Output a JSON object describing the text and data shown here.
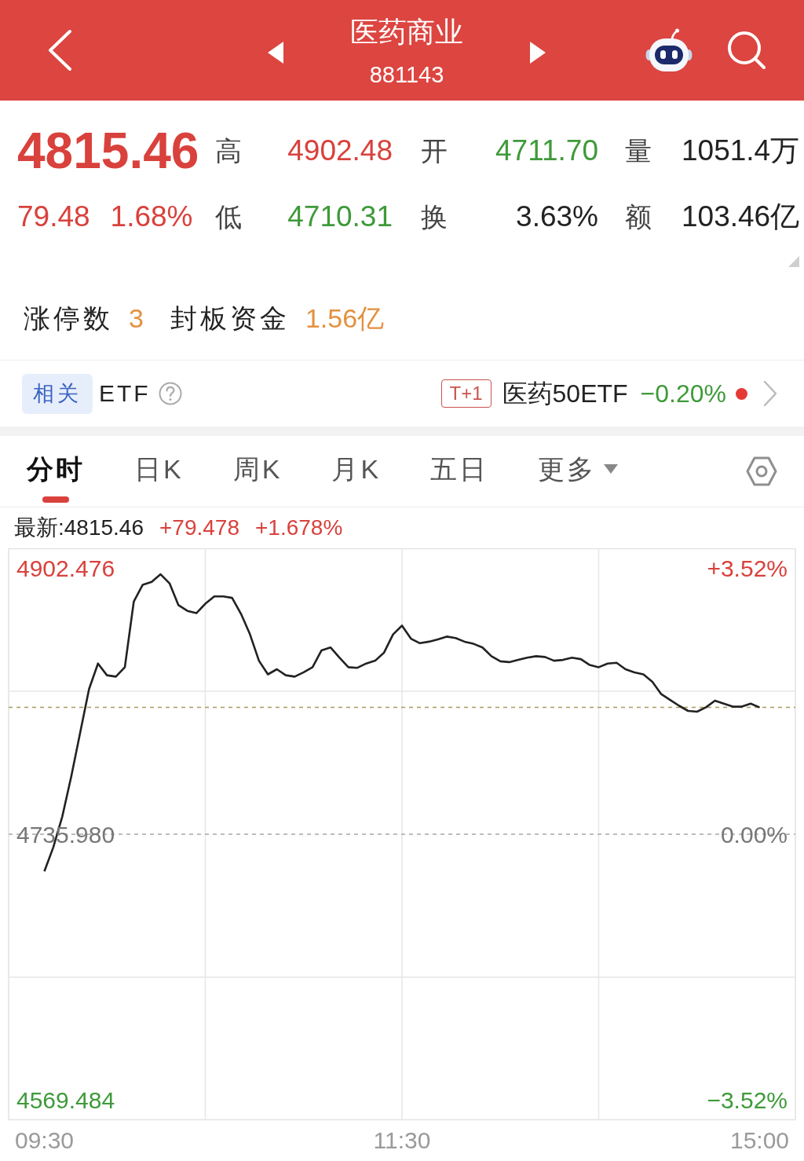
{
  "header": {
    "title": "医药商业",
    "code": "881143"
  },
  "quote": {
    "price": "4815.46",
    "change": "79.48",
    "change_percent": "1.68%",
    "stats": [
      {
        "label": "高",
        "value": "4902.48",
        "color": "#d9413c"
      },
      {
        "label": "开",
        "value": "4711.70",
        "color": "#3f9a3a"
      },
      {
        "label": "量",
        "value": "1051.4万",
        "color": "#222222"
      },
      {
        "label": "低",
        "value": "4710.31",
        "color": "#3f9a3a"
      },
      {
        "label": "换",
        "value": "3.63%",
        "color": "#222222"
      },
      {
        "label": "额",
        "value": "103.46亿",
        "color": "#222222"
      }
    ]
  },
  "limit_up": [
    {
      "label": "涨停数",
      "value": "3"
    },
    {
      "label": "封板资金",
      "value": "1.56亿"
    }
  ],
  "etf": {
    "badge": "相关",
    "label": "ETF",
    "tag": "T+1",
    "name": "医药50ETF",
    "change": "−0.20%"
  },
  "tabs": [
    {
      "label": "分时",
      "selected": true,
      "kind": "plain"
    },
    {
      "label": "日K",
      "selected": false,
      "kind": "plain"
    },
    {
      "label": "周K",
      "selected": false,
      "kind": "plain"
    },
    {
      "label": "月K",
      "selected": false,
      "kind": "plain"
    },
    {
      "label": "五日",
      "selected": false,
      "kind": "plain"
    },
    {
      "label": "更多",
      "selected": false,
      "kind": "dropdown"
    }
  ],
  "chart": {
    "legend": {
      "latest": "最新:4815.46",
      "change": "+79.478",
      "percent": "+1.678%"
    },
    "percent_labels": [
      "+3.52%",
      "0.00%",
      "−3.52%"
    ],
    "chart_data": {
      "type": "line",
      "grid": true,
      "categories": [
        "09:30",
        null,
        null,
        null,
        null,
        null,
        null,
        null,
        null,
        null,
        null,
        null,
        null,
        null,
        null,
        null,
        null,
        null,
        null,
        null,
        null,
        null,
        null,
        null,
        null,
        null,
        null,
        null,
        null,
        null,
        null,
        null,
        null,
        null,
        null,
        null,
        null,
        null,
        null,
        null,
        "11:30",
        null,
        null,
        null,
        null,
        null,
        null,
        null,
        null,
        null,
        null,
        null,
        null,
        null,
        null,
        null,
        null,
        null,
        null,
        null,
        null,
        null,
        null,
        null,
        null,
        null,
        null,
        null,
        null,
        null,
        null,
        null,
        null,
        null,
        null,
        null,
        null,
        null,
        null,
        null,
        "15:00"
      ],
      "values": [
        4712.7,
        4727.8,
        4747.0,
        4772.1,
        4799.6,
        4827.0,
        4843.0,
        4835.7,
        4834.8,
        4840.7,
        4881.9,
        4892.4,
        4894.2,
        4899.0,
        4893.3,
        4879.6,
        4876.0,
        4874.6,
        4880.5,
        4885.1,
        4885.1,
        4884.2,
        4874.1,
        4861.3,
        4844.8,
        4836.2,
        4839.4,
        4835.7,
        4834.8,
        4837.5,
        4840.7,
        4851.3,
        4853.1,
        4846.7,
        4840.7,
        4840.3,
        4843.0,
        4844.8,
        4849.9,
        4861.3,
        4866.8,
        4858.6,
        4855.8,
        4856.7,
        4858.1,
        4859.9,
        4859.0,
        4856.7,
        4855.4,
        4853.1,
        4847.6,
        4844.4,
        4843.9,
        4845.3,
        4846.7,
        4847.6,
        4847.1,
        4844.8,
        4845.3,
        4846.7,
        4845.8,
        4842.1,
        4840.7,
        4843.0,
        4843.5,
        4839.4,
        4837.5,
        4836.2,
        4831.6,
        4823.8,
        4820.1,
        4816.5,
        4813.3,
        4812.8,
        4815.6,
        4819.7,
        4817.9,
        4816.0,
        4816.0,
        4817.9,
        4815.5
      ],
      "ylim": [
        4556.68,
        4915.28
      ],
      "yticks": [
        {
          "value": 4902.476,
          "label": "4902.476"
        },
        {
          "value": 4735.98,
          "label": "4735.980"
        },
        {
          "value": 4569.484,
          "label": "4569.484"
        }
      ],
      "ref_lines": [
        {
          "axis": "y",
          "value": 4735.98,
          "color": "#a8a8a8"
        },
        {
          "axis": "y",
          "value": 4815.5,
          "color": "#a59d5e"
        }
      ]
    }
  }
}
